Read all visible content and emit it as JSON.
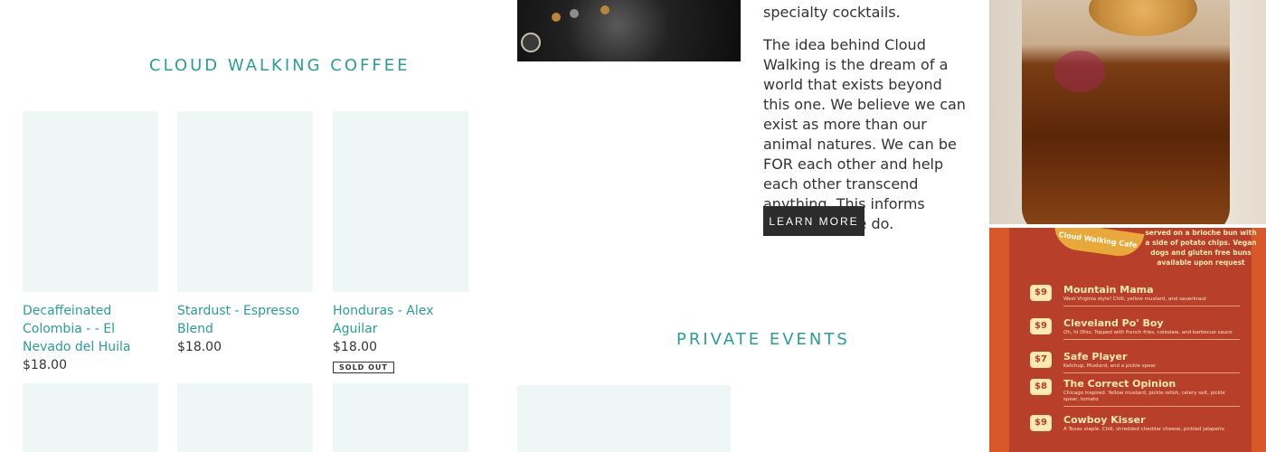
{
  "shop": {
    "title": "CLOUD WALKING COFFEE",
    "products": [
      {
        "name": "Decaffeinated Colombia - - El Nevado del Huila",
        "price": "$18.00",
        "sold_out": ""
      },
      {
        "name": "Stardust - Espresso Blend",
        "price": "$18.00",
        "sold_out": ""
      },
      {
        "name": "Honduras - Alex Aguilar",
        "price": "$18.00",
        "sold_out": "SOLD OUT"
      }
    ]
  },
  "about": {
    "line_top": "specialty cocktails.",
    "body": "The idea behind Cloud Walking is the dream of a world that exists beyond this one. We believe we can exist as more than our animal natures. We can be FOR each other and help each other transcend anything. This informs everything we do.",
    "button_label": "LEARN MORE"
  },
  "events": {
    "title": "PRIVATE EVENTS"
  },
  "menu_image": {
    "logo": "Cloud Walking Cafe",
    "intro": "served on a brioche bun with a side of potato chips. Vegan dogs and gluten free buns available upon request",
    "items": [
      {
        "price": "$9",
        "name": "Mountain Mama",
        "desc": "West Virginia style! Chili, yellow mustard, and sauerkraut"
      },
      {
        "price": "$9",
        "name": "Cleveland Po' Boy",
        "desc": "Oh, hi Ohio. Topped with french fries, coleslaw, and barbecue sauce"
      },
      {
        "price": "$7",
        "name": "Safe Player",
        "desc": "Ketchup, Mustard, and a pickle spear"
      },
      {
        "price": "$8",
        "name": "The Correct Opinion",
        "desc": "Chicago inspired. Yellow mustard, pickle relish, celery salt, pickle spear, tomato"
      },
      {
        "price": "$9",
        "name": "Cowboy Kisser",
        "desc": "A Texas staple. Chili, shredded cheddar cheese, pickled jalapeño"
      }
    ]
  }
}
